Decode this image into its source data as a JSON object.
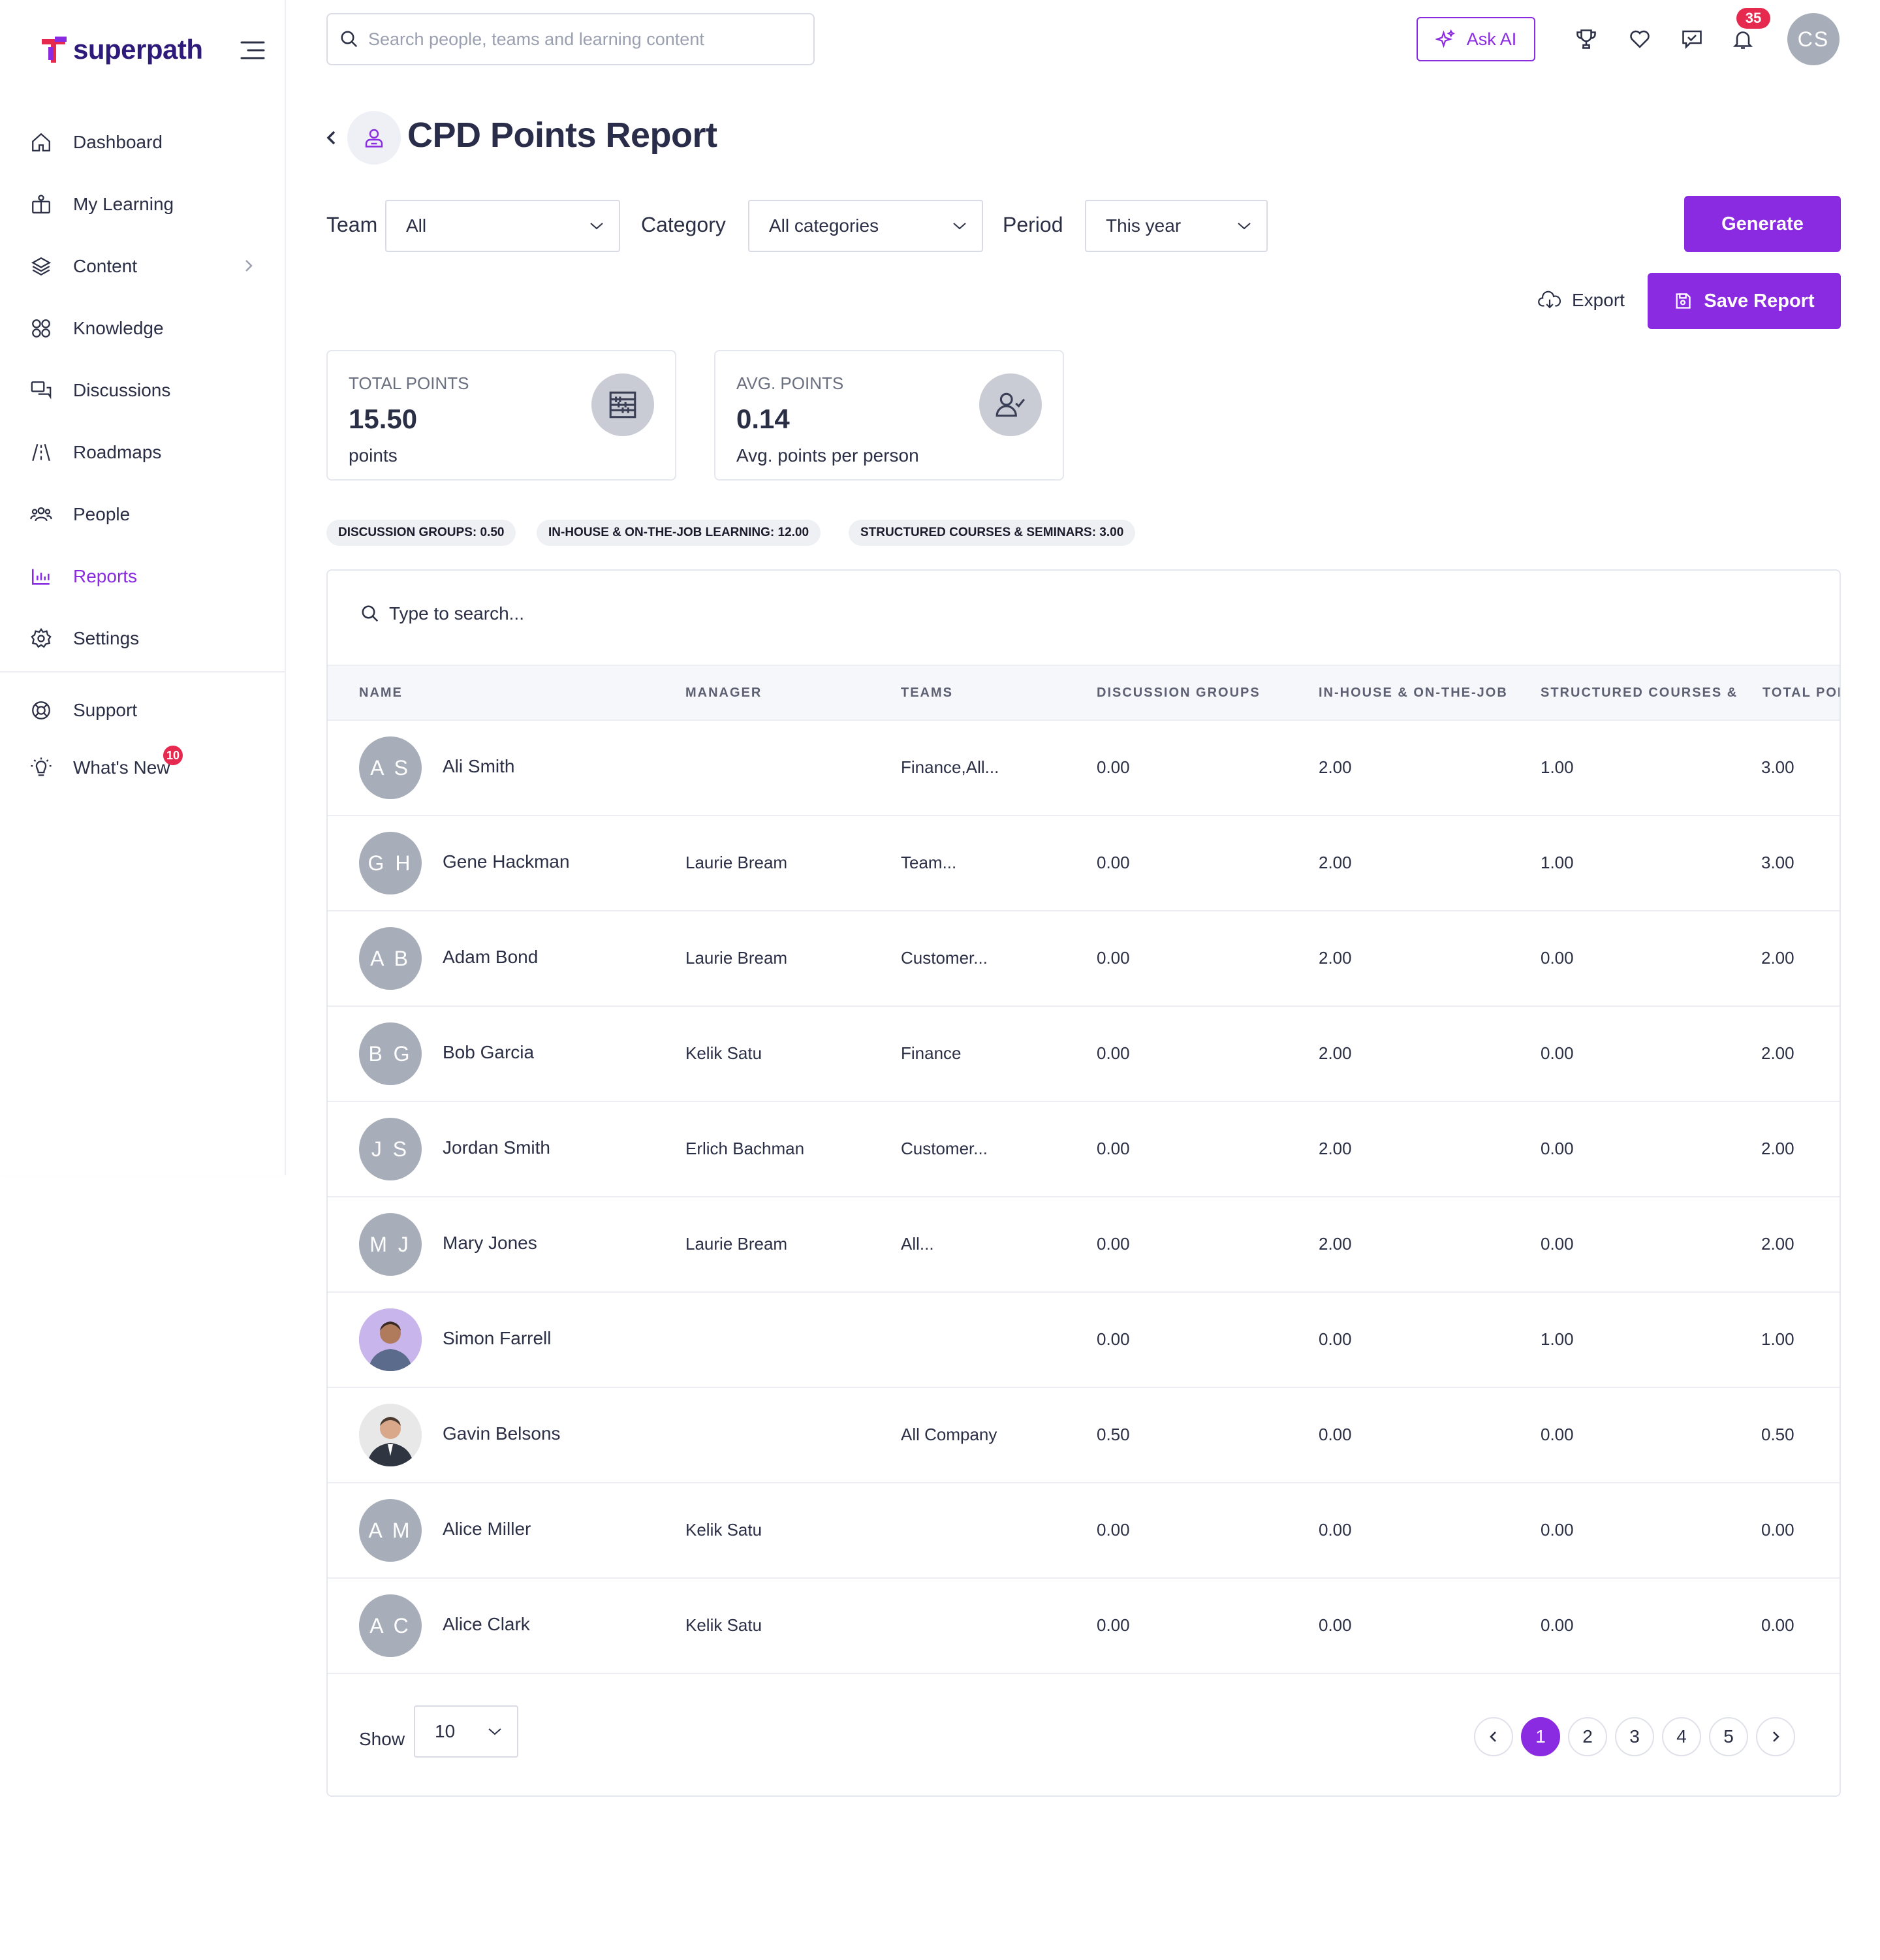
{
  "brand": {
    "name": "superpath",
    "accent": "#8a2be2"
  },
  "sidebar": {
    "items": [
      {
        "label": "Dashboard",
        "icon": "home-icon"
      },
      {
        "label": "My Learning",
        "icon": "learning-icon"
      },
      {
        "label": "Content",
        "icon": "layers-icon"
      },
      {
        "label": "Knowledge",
        "icon": "knowledge-icon"
      },
      {
        "label": "Discussions",
        "icon": "chat-icon"
      },
      {
        "label": "Roadmaps",
        "icon": "road-icon"
      },
      {
        "label": "People",
        "icon": "people-icon"
      },
      {
        "label": "Reports",
        "icon": "chart-icon"
      },
      {
        "label": "Settings",
        "icon": "gear-icon"
      }
    ],
    "secondary": [
      {
        "label": "Support",
        "icon": "support-icon"
      },
      {
        "label": "What's New",
        "icon": "bulb-icon",
        "badge": "10"
      }
    ]
  },
  "header": {
    "search_placeholder": "Search people, teams and learning content",
    "ask_ai": "Ask AI",
    "notification_count": "35",
    "user_initials": "CS"
  },
  "page": {
    "title": "CPD Points Report"
  },
  "filters": {
    "team_label": "Team",
    "team_value": "All",
    "category_label": "Category",
    "category_value": "All categories",
    "period_label": "Period",
    "period_value": "This year",
    "generate": "Generate",
    "export": "Export",
    "save_report": "Save Report"
  },
  "stats": {
    "total": {
      "label": "TOTAL POINTS",
      "value": "15.50",
      "sub": "points"
    },
    "avg": {
      "label": "AVG. POINTS",
      "value": "0.14",
      "sub": "Avg. points per person"
    }
  },
  "chips": [
    "DISCUSSION GROUPS: 0.50",
    "IN-HOUSE & ON-THE-JOB LEARNING: 12.00",
    "STRUCTURED COURSES & SEMINARS: 3.00"
  ],
  "table": {
    "search_placeholder": "Type to search...",
    "columns": [
      "NAME",
      "MANAGER",
      "TEAMS",
      "DISCUSSION GROUPS",
      "IN-HOUSE & ON-THE-JOB",
      "STRUCTURED COURSES &",
      "TOTAL POI"
    ],
    "rows": [
      {
        "initials": "AS",
        "name": "Ali Smith",
        "manager": "",
        "teams": "Finance,All...",
        "discussion": "0.00",
        "inhouse": "2.00",
        "structured": "1.00",
        "total": "3.00"
      },
      {
        "initials": "GH",
        "name": "Gene Hackman",
        "manager": "Laurie Bream",
        "teams": "Team...",
        "discussion": "0.00",
        "inhouse": "2.00",
        "structured": "1.00",
        "total": "3.00"
      },
      {
        "initials": "AB",
        "name": "Adam Bond",
        "manager": "Laurie Bream",
        "teams": "Customer...",
        "discussion": "0.00",
        "inhouse": "2.00",
        "structured": "0.00",
        "total": "2.00"
      },
      {
        "initials": "BG",
        "name": "Bob Garcia",
        "manager": "Kelik Satu",
        "teams": "Finance",
        "discussion": "0.00",
        "inhouse": "2.00",
        "structured": "0.00",
        "total": "2.00"
      },
      {
        "initials": "JS",
        "name": "Jordan Smith",
        "manager": "Erlich Bachman",
        "teams": "Customer...",
        "discussion": "0.00",
        "inhouse": "2.00",
        "structured": "0.00",
        "total": "2.00"
      },
      {
        "initials": "MJ",
        "name": "Mary Jones",
        "manager": "Laurie Bream",
        "teams": "All...",
        "discussion": "0.00",
        "inhouse": "2.00",
        "structured": "0.00",
        "total": "2.00"
      },
      {
        "initials": "",
        "name": "Simon Farrell",
        "manager": "",
        "teams": "",
        "discussion": "0.00",
        "inhouse": "0.00",
        "structured": "1.00",
        "total": "1.00",
        "photo": "purple"
      },
      {
        "initials": "",
        "name": "Gavin Belsons",
        "manager": "",
        "teams": "All Company",
        "discussion": "0.50",
        "inhouse": "0.00",
        "structured": "0.00",
        "total": "0.50",
        "photo": "gray"
      },
      {
        "initials": "AM",
        "name": "Alice Miller",
        "manager": "Kelik Satu",
        "teams": "",
        "discussion": "0.00",
        "inhouse": "0.00",
        "structured": "0.00",
        "total": "0.00"
      },
      {
        "initials": "AC",
        "name": "Alice Clark",
        "manager": "Kelik Satu",
        "teams": "",
        "discussion": "0.00",
        "inhouse": "0.00",
        "structured": "0.00",
        "total": "0.00"
      }
    ]
  },
  "pagination": {
    "show_label": "Show",
    "page_size": "10",
    "pages": [
      "1",
      "2",
      "3",
      "4",
      "5"
    ],
    "current": "1"
  }
}
